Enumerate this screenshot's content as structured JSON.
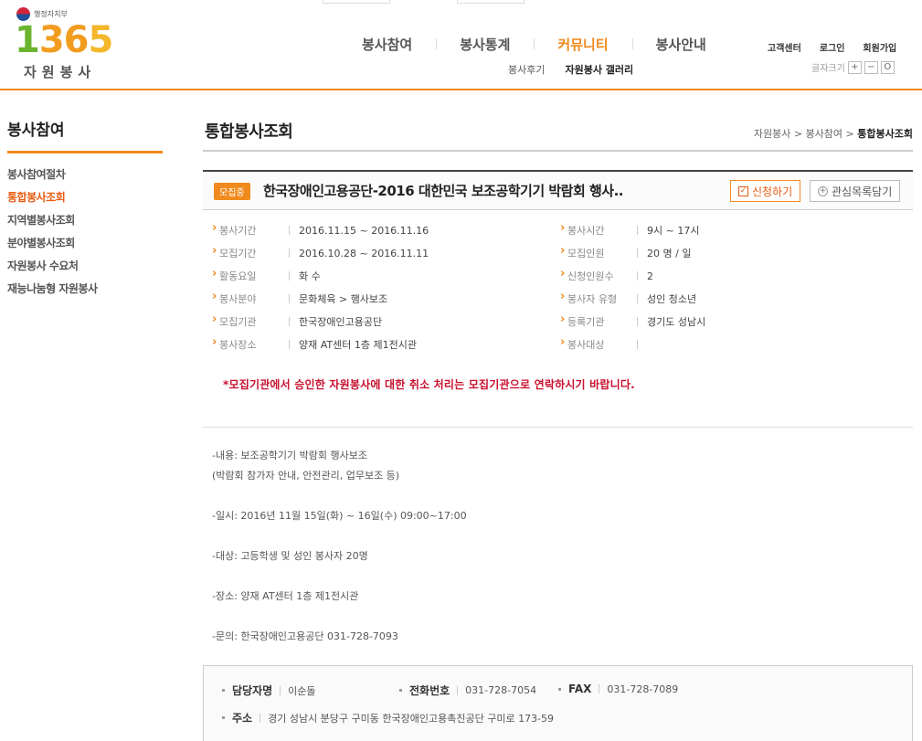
{
  "header": {
    "ministry": "행정자치부",
    "logo_number": {
      "one": "1",
      "six": "36",
      "five": "5"
    },
    "logo_sub": "자원봉사",
    "gnb": [
      {
        "label": "봉사참여"
      },
      {
        "label": "봉사통계"
      },
      {
        "label": "커뮤니티"
      },
      {
        "label": "봉사안내"
      }
    ],
    "subnav": [
      {
        "label": "봉사후기"
      },
      {
        "label": "자원봉사 갤러리"
      }
    ],
    "util": [
      {
        "label": "고객센터"
      },
      {
        "label": "로그인"
      },
      {
        "label": "회원가입"
      }
    ],
    "fontsize_label": "글자크기",
    "fontsize_plus": "+",
    "fontsize_minus": "−",
    "fontsize_reset": "O"
  },
  "lnb": {
    "title": "봉사참여",
    "items": [
      {
        "label": "봉사참여절차"
      },
      {
        "label": "통합봉사조회"
      },
      {
        "label": "지역별봉사조회"
      },
      {
        "label": "분야별봉사조회"
      },
      {
        "label": "자원봉사 수요처"
      },
      {
        "label": "재능나눔형 자원봉사"
      }
    ]
  },
  "content": {
    "title": "통합봉사조회",
    "breadcrumb": {
      "a": "자원봉사",
      "b": "봉사참여",
      "c": "통합봉사조회",
      "sep": ">"
    },
    "badge": "모집중",
    "volunteer_title": "한국장애인고용공단-2016 대한민국 보조공학기기 박람회 행사..",
    "apply_label": "신청하기",
    "wish_label": "관심목록담기",
    "details_left": [
      {
        "label": "봉사기간",
        "value": "2016.11.15 ~ 2016.11.16"
      },
      {
        "label": "모집기간",
        "value": "2016.10.28 ~ 2016.11.11"
      },
      {
        "label": "활동요일",
        "value": "화 수"
      },
      {
        "label": "봉사분야",
        "value": "문화체육 > 행사보조"
      },
      {
        "label": "모집기관",
        "value": "한국장애인고용공단"
      },
      {
        "label": "봉사장소",
        "value": "양재 AT센터 1층 제1전시관"
      }
    ],
    "details_right": [
      {
        "label": "봉사시간",
        "value": "9시 ~ 17시"
      },
      {
        "label": "모집인원",
        "value": "20 명 / 일"
      },
      {
        "label": "신청인원수",
        "value": "2"
      },
      {
        "label": "봉사자 유형",
        "value": "성인 청소년"
      },
      {
        "label": "등록기관",
        "value": "경기도 성남시"
      },
      {
        "label": "봉사대상",
        "value": ""
      }
    ],
    "notice": "*모집기관에서 승인한 자원봉사에 대한 취소 처리는 모집기관으로 연락하시기 바랍니다.",
    "description": {
      "line1": "-내용: 보조공학기기 박람회 행사보조",
      "line2": "(박람회 참가자 안내, 안전관리, 업무보조 등)",
      "line3": "-일시: 2016년 11월 15일(화) ~ 16일(수) 09:00~17:00",
      "line4": "-대상: 고등학생 및 성인 봉사자 20명",
      "line5": "-장소: 양재 AT센터 1층 제1전시관",
      "line6": "-문의: 한국장애인고용공단 031-728-7093"
    },
    "contact": {
      "manager_label": "담당자명",
      "manager": "이순돌",
      "phone_label": "전화번호",
      "phone": "031-728-7054",
      "fax_label": "FAX",
      "fax": "031-728-7089",
      "address_label": "주소",
      "address": "경기 성남시 분당구 구미동 한국장애인고용촉진공단 구미로 173-59"
    }
  }
}
